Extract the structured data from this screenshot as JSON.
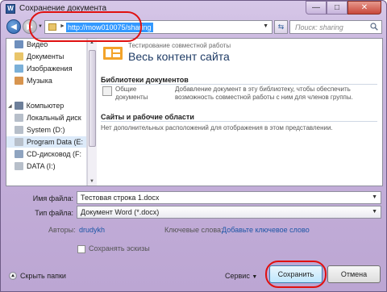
{
  "window": {
    "title": "Сохранение документа",
    "app_letter": "W"
  },
  "address": {
    "url": "http://mow010075/sharing"
  },
  "search": {
    "placeholder": "Поиск: sharing"
  },
  "nav": {
    "items": [
      {
        "label": "Видео",
        "color": "#6e8fbd"
      },
      {
        "label": "Документы",
        "color": "#e9c56a"
      },
      {
        "label": "Изображения",
        "color": "#7bb0d8"
      },
      {
        "label": "Музыка",
        "color": "#d8954f"
      },
      {
        "label": "Компьютер",
        "color": "#6d7f9a"
      },
      {
        "label": "Локальный диск",
        "color": "#b7bfca"
      },
      {
        "label": "System (D:)",
        "color": "#b7bfca"
      },
      {
        "label": "Program Data (E:",
        "color": "#b7bfca"
      },
      {
        "label": "CD-дисковод (F:",
        "color": "#8fa4c0"
      },
      {
        "label": "DATA (I:)",
        "color": "#b7bfca"
      }
    ]
  },
  "content": {
    "subtitle": "Тестирование совместной работы",
    "title": "Весь контент сайта",
    "libraries": {
      "heading": "Библиотеки документов",
      "item_name": "Общие документы",
      "item_desc": "Добавление документ в эту библиотеку, чтобы обеспечить возможность совместной работы с ним для членов группы."
    },
    "sites": {
      "heading": "Сайты и рабочие области",
      "empty": "Нет дополнительных расположений для отображения в этом представлении."
    }
  },
  "form": {
    "filename_label": "Имя файла:",
    "filename_value": "Тестовая строка 1.docx",
    "filetype_label": "Тип файла:",
    "filetype_value": "Документ Word (*.docx)",
    "authors_label": "Авторы:",
    "authors_value": "drudykh",
    "keywords_label": "Ключевые слова:",
    "keywords_value": "Добавьте ключевое слово",
    "thumbs_label": "Сохранять эскизы"
  },
  "footer": {
    "hide_folders": "Скрыть папки",
    "tools": "Сервис",
    "save": "Сохранить",
    "cancel": "Отмена"
  },
  "colors": {
    "accent": "#3399ff",
    "annotation": "#e01010",
    "link": "#1c55a6"
  }
}
